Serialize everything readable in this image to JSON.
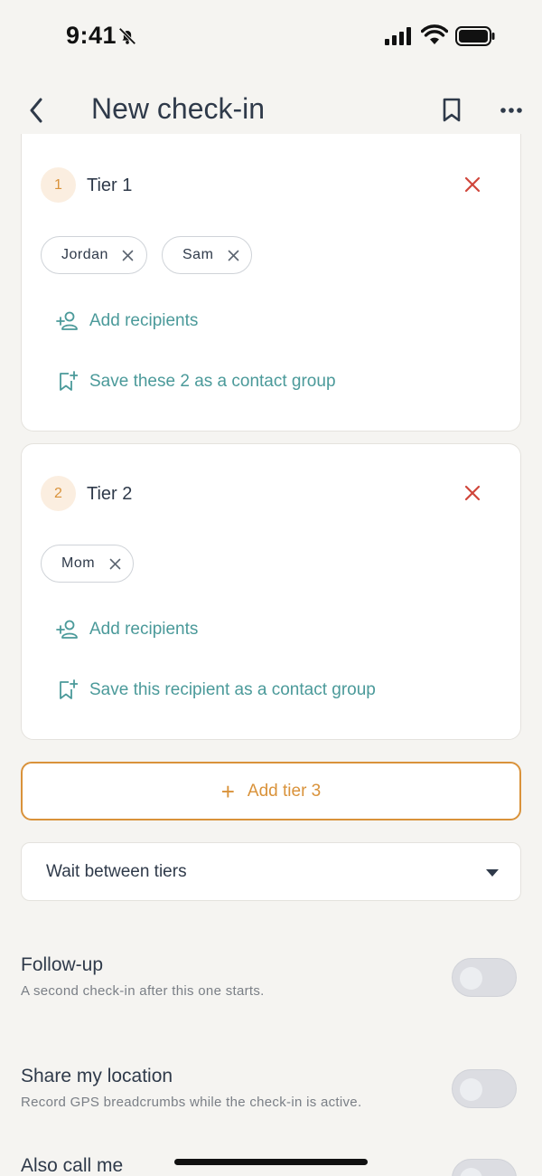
{
  "status": {
    "time": "9:41"
  },
  "header": {
    "title": "New check-in"
  },
  "tiers": [
    {
      "number": "1",
      "name": "Tier 1",
      "recipients": [
        "Jordan",
        "Sam"
      ],
      "add_label": "Add recipients",
      "save_label": "Save these 2 as a contact group"
    },
    {
      "number": "2",
      "name": "Tier 2",
      "recipients": [
        "Mom"
      ],
      "add_label": "Add recipients",
      "save_label": "Save this recipient as a contact group"
    }
  ],
  "add_tier": {
    "icon": "+",
    "label": "Add tier 3"
  },
  "wait_select": {
    "value": "Wait between tiers"
  },
  "settings": [
    {
      "title": "Follow-up",
      "subtitle": "A second check-in after this one starts.",
      "enabled": false
    },
    {
      "title": "Share my location",
      "subtitle": "Record GPS breadcrumbs while the check-in is active.",
      "enabled": false
    },
    {
      "title": "Also call me",
      "subtitle": "",
      "enabled": false
    }
  ],
  "colors": {
    "accent": "#d9923a",
    "teal": "#4b9a9a",
    "danger": "#d0463b",
    "background": "#f5f4f1"
  },
  "icons": {
    "back": "chevron-left-icon",
    "bookmark": "bookmark-icon",
    "more": "more-horizontal-icon",
    "remove": "close-icon",
    "add_person": "add-person-icon",
    "save_group": "bookmark-plus-icon",
    "dropdown": "caret-down-icon"
  }
}
